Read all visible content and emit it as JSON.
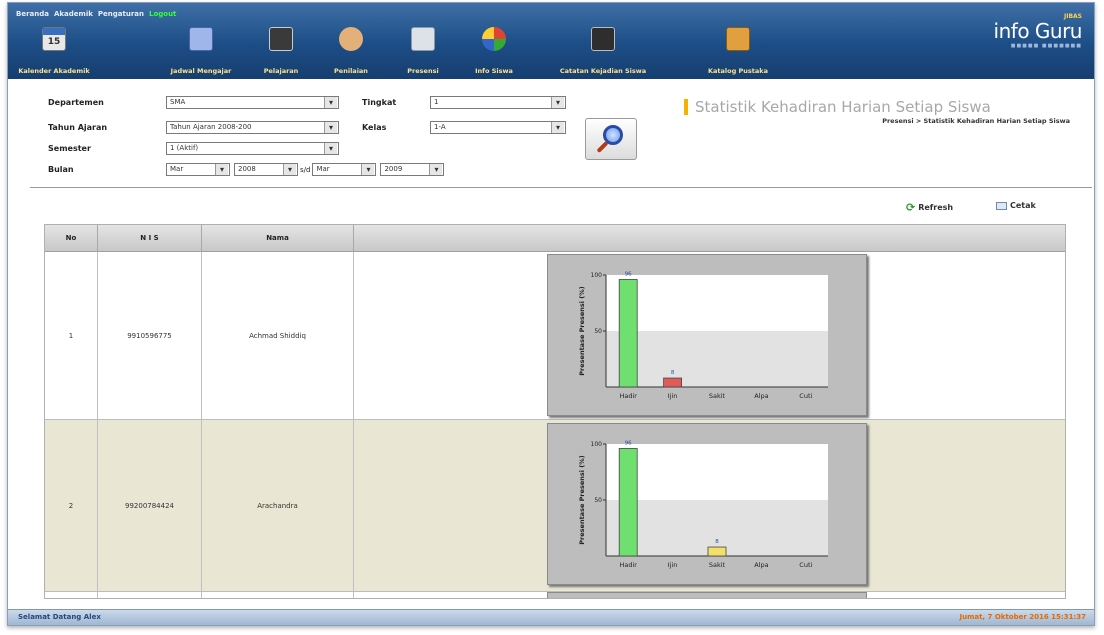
{
  "header": {
    "top_links": [
      "Beranda",
      "Akademik",
      "Pengaturan",
      "Logout"
    ],
    "logo": "info Guru",
    "nav": [
      {
        "label": "Kalender Akademik",
        "icon": "calendar-icon",
        "color": "#d9d9d9"
      },
      {
        "label": "Jadwal Mengajar",
        "icon": "schedule-icon",
        "color": "#8aa6e0"
      },
      {
        "label": "Pelajaran",
        "icon": "book-icon",
        "color": "#3a3a3a"
      },
      {
        "label": "Penilaian",
        "icon": "thumb-icon",
        "color": "#e3b079"
      },
      {
        "label": "Presensi",
        "icon": "attendance-icon",
        "color": "#d0d5dc"
      },
      {
        "label": "Info Siswa",
        "icon": "students-icon",
        "color": "#cc3344"
      },
      {
        "label": "Catatan Kejadian Siswa",
        "icon": "notes-icon",
        "color": "#2e2e2e"
      },
      {
        "label": "Katalog Pustaka",
        "icon": "library-icon",
        "color": "#e0a040"
      }
    ]
  },
  "form": {
    "departemen_label": "Departemen",
    "departemen_value": "SMA",
    "tahun_label": "Tahun Ajaran",
    "tahun_value": "Tahun Ajaran 2008-200",
    "semester_label": "Semester",
    "semester_value": "1 (Aktif)",
    "bulan_label": "Bulan",
    "bulan_from_month": "Mar",
    "bulan_from_year": "2008",
    "sd": "s/d",
    "bulan_to_month": "Mar",
    "bulan_to_year": "2009",
    "tingkat_label": "Tingkat",
    "tingkat_value": "1",
    "kelas_label": "Kelas",
    "kelas_value": "1-A"
  },
  "page_title": "Statistik Kehadiran Harian Setiap Siswa",
  "breadcrumb": "Presensi > Statistik Kehadiran Harian Setiap Siswa",
  "actions": {
    "refresh": "Refresh",
    "cetak": "Cetak"
  },
  "table": {
    "headers": [
      "No",
      "N I S",
      "Nama"
    ],
    "rows": [
      {
        "no": "1",
        "nis": "9910596775",
        "nama": "Achmad Shiddiq"
      },
      {
        "no": "2",
        "nis": "99200784424",
        "nama": "Arachandra"
      }
    ]
  },
  "chart_data": [
    {
      "type": "bar",
      "ylabel": "Presentase Presensi (%)",
      "categories": [
        "Hadir",
        "Ijin",
        "Sakit",
        "Alpa",
        "Cuti"
      ],
      "values": [
        96,
        8,
        0,
        0,
        0
      ],
      "colors": [
        "#6fe06f",
        "#e05a5a",
        "#f2e06a",
        "#7a9ce8",
        "#c89ae0"
      ],
      "ylim": [
        0,
        100
      ],
      "yticks": [
        50,
        100
      ],
      "data_labels": [
        "96",
        "8",
        "",
        "",
        ""
      ]
    },
    {
      "type": "bar",
      "ylabel": "Presentase Presensi (%)",
      "categories": [
        "Hadir",
        "Ijin",
        "Sakit",
        "Alpa",
        "Cuti"
      ],
      "values": [
        96,
        0,
        8,
        0,
        0
      ],
      "colors": [
        "#6fe06f",
        "#e05a5a",
        "#f2e06a",
        "#7a9ce8",
        "#c89ae0"
      ],
      "ylim": [
        0,
        100
      ],
      "yticks": [
        50,
        100
      ],
      "data_labels": [
        "96",
        "",
        "8",
        "",
        ""
      ]
    }
  ],
  "footer": {
    "left": "Selamat Datang Alex",
    "right": "Jumat, 7 Oktober 2016 15:31:37"
  }
}
